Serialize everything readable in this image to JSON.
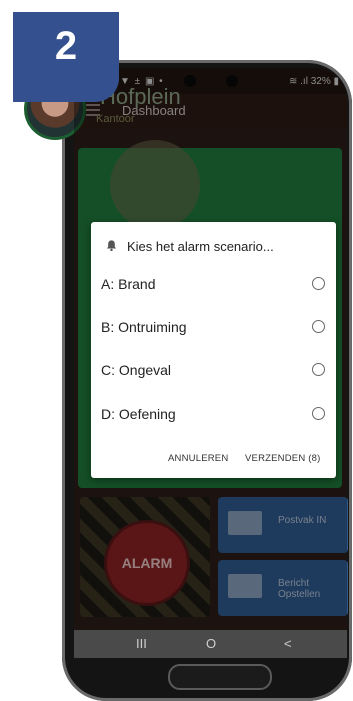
{
  "step_badge": "2",
  "status_bar": {
    "left": "▼ ± ▣ •",
    "right": "≋ .ıl 32% ▮"
  },
  "app": {
    "title": "Dashboard"
  },
  "location": {
    "name": "Hofplein",
    "sublabel": "Kantoor"
  },
  "tiles": {
    "alarm": "ALARM",
    "inbox": "Postvak IN",
    "compose_line1": "Bericht",
    "compose_line2": "Opstellen"
  },
  "dialog": {
    "title": "Kies het alarm scenario...",
    "options": [
      {
        "label": "A: Brand",
        "selected": false
      },
      {
        "label": "B: Ontruiming",
        "selected": false
      },
      {
        "label": "C: Ongeval",
        "selected": false
      },
      {
        "label": "D: Oefening",
        "selected": false
      }
    ],
    "cancel": "ANNULEREN",
    "send": "VERZENDEN (8)"
  },
  "nav": {
    "recent": "III",
    "home": "O",
    "back": "<"
  },
  "colors": {
    "badge": "#34508f",
    "card": "#1f7a3c",
    "tile": "#2e5a8e",
    "alarm": "#8b2222"
  }
}
